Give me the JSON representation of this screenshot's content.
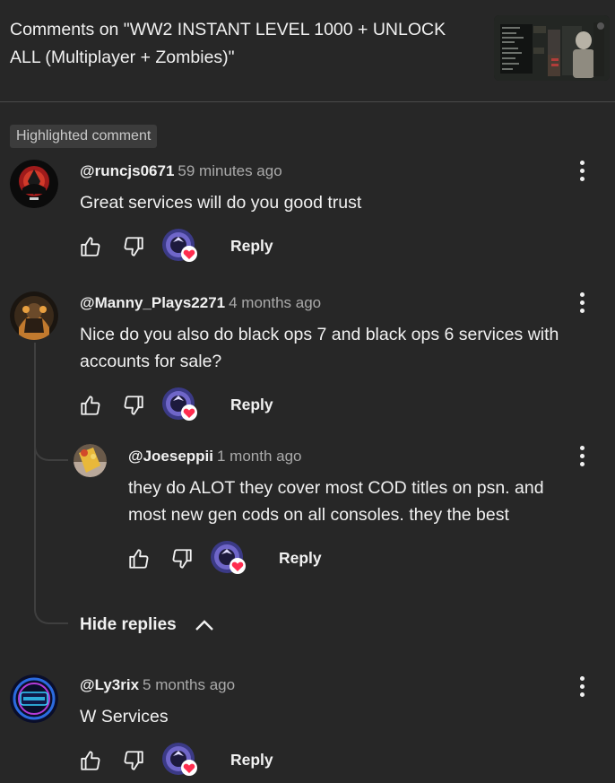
{
  "header": {
    "title": "Comments on \"WW2 INSTANT LEVEL 1000 + UNLOCK ALL (Multiplayer + Zombies)\""
  },
  "highlighted_label": "Highlighted comment",
  "reply_label": "Reply",
  "hide_replies_label": "Hide replies",
  "comments": [
    {
      "handle": "@runcjs0671",
      "time": "59 minutes ago",
      "text": "Great services will do you good trust"
    },
    {
      "handle": "@Manny_Plays2271",
      "time": "4 months ago",
      "text": "Nice do you also do black ops 7 and black ops 6 services with accounts for sale?"
    },
    {
      "handle": "@Joeseppii",
      "time": "1 month ago",
      "text": "they do ALOT they cover most COD titles on psn. and most new gen cods on all consoles. they the best"
    },
    {
      "handle": "@Ly3rix",
      "time": "5 months ago",
      "text": "W Services"
    }
  ],
  "icons": {
    "like": "thumb-up-icon",
    "dislike": "thumb-down-icon",
    "creator_heart": "creator-heart-icon",
    "menu": "more-vert-icon",
    "hide": "chevron-up-icon"
  },
  "colors": {
    "background": "#272727",
    "text": "#f1f1f1",
    "secondary_text": "#aaaaaa",
    "heart": "#ff2d4f",
    "chip": "#3c3c3c"
  }
}
